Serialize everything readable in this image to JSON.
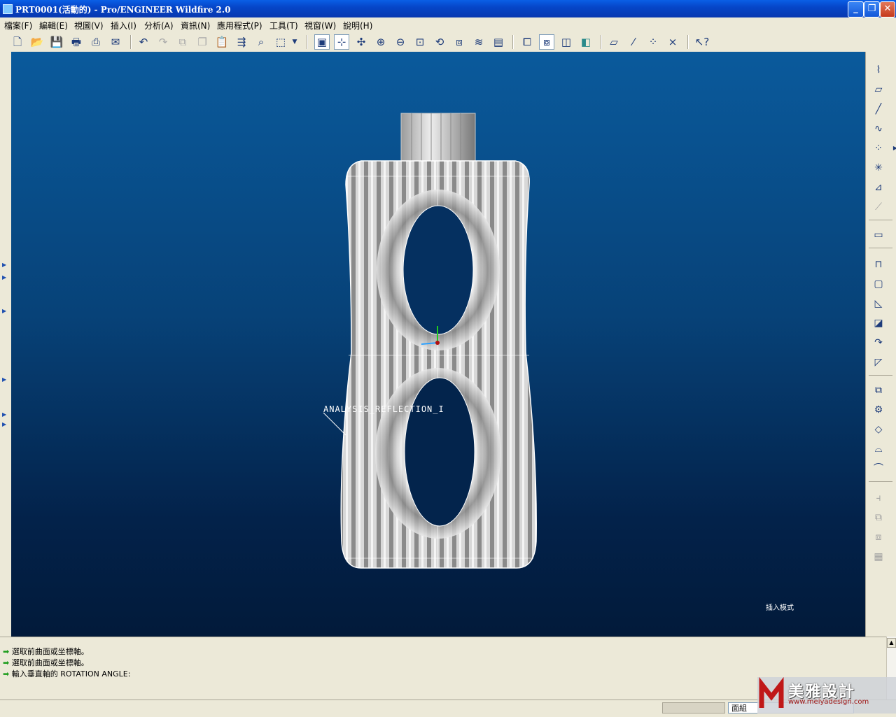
{
  "window": {
    "title": "PRT0001(活動的) - Pro/ENGINEER Wildfire 2.0",
    "minimize": "_",
    "restore": "❐",
    "close": "✕"
  },
  "menu": {
    "items": [
      "檔案(F)",
      "編輯(E)",
      "視圖(V)",
      "插入(I)",
      "分析(A)",
      "資訊(N)",
      "應用程式(P)",
      "工具(T)",
      "視窗(W)",
      "說明(H)"
    ]
  },
  "toolbar": {
    "icons": [
      "new-icon",
      "open-icon",
      "save-icon",
      "print-icon",
      "send-icon",
      "email-icon",
      "undo-icon",
      "redo-icon",
      "cut-icon",
      "copy-icon",
      "paste-icon",
      "regenerate-icon",
      "find-icon",
      "select-box-icon",
      "dropdown-arrow-icon",
      "repaint-icon",
      "spin-center-icon",
      "orient-icon",
      "zoom-in-icon",
      "zoom-out-icon",
      "refit-icon",
      "reorient-icon",
      "saved-views-icon",
      "layers-icon",
      "view-manager-icon",
      "wireframe-icon",
      "hidden-line-icon",
      "no-hidden-icon",
      "shading-icon",
      "datum-planes-icon",
      "datum-axes-icon",
      "datum-points-icon",
      "coordinate-systems-icon",
      "context-help-icon"
    ]
  },
  "viewport": {
    "annotation_label": "ANALYSIS_REFLECTION_I",
    "mode_label": "插入模式"
  },
  "messages": [
    "選取前曲面或坐標軸。",
    "選取前曲面或坐標軸。",
    "輸入垂直軸的 ROTATION ANGLE:"
  ],
  "status": {
    "filter_value": "面組"
  },
  "logo": {
    "brand": "美雅設計",
    "url": "www.meiyadesign.com"
  }
}
